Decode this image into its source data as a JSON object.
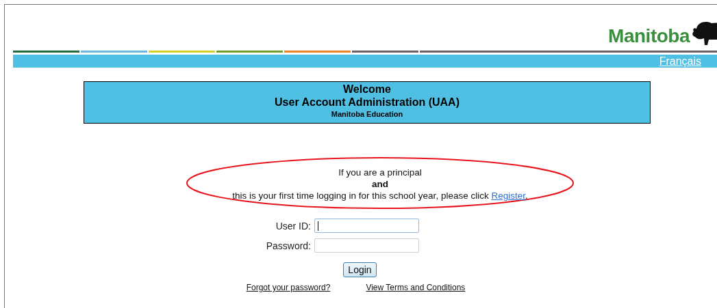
{
  "header": {
    "logo_text": "Manitoba",
    "stripes": [
      {
        "color": "#1f6b3a"
      },
      {
        "color": "#6cb8e0"
      },
      {
        "color": "#d5d12a"
      },
      {
        "color": "#6f9c2a"
      },
      {
        "color": "#e8862a"
      },
      {
        "color": "#6b5f63"
      }
    ],
    "language_link": "Français"
  },
  "banner": {
    "title": "Welcome",
    "subtitle": "User Account Administration (UAA)",
    "department": "Manitoba Education"
  },
  "notice": {
    "line_1": "If you are a principal",
    "line_2": "and",
    "line_3": "this is your first time logging in for this school year, please click",
    "link": "Register",
    "after_link": "."
  },
  "form": {
    "fields": [
      {
        "label": "User ID:",
        "focused": true
      },
      {
        "label": "Password:",
        "focused": false
      }
    ],
    "button": "Login"
  },
  "links": [
    "Forgot your password?",
    "View Terms and Conditions"
  ]
}
